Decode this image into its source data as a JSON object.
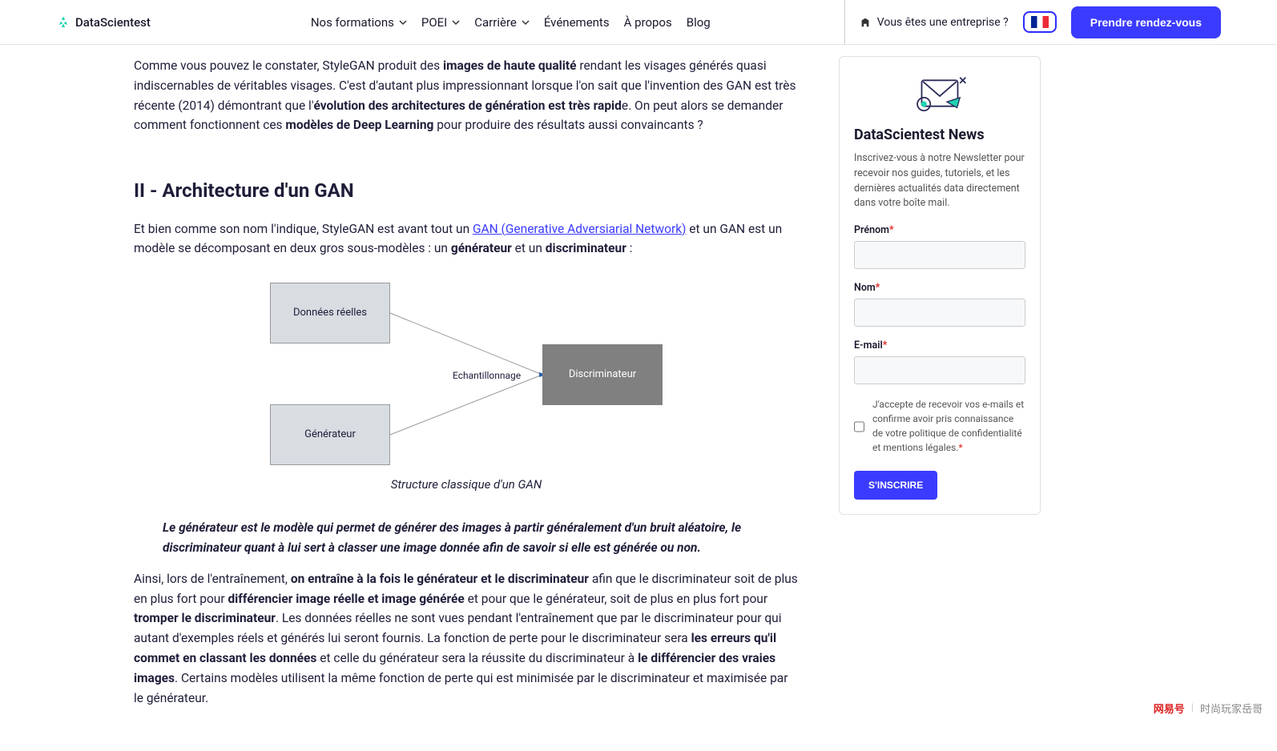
{
  "header": {
    "logo_text": "DataScientest",
    "nav": {
      "formations": "Nos formations",
      "poei": "POEI",
      "carriere": "Carrière",
      "evenements": "Événements",
      "apropos": "À propos",
      "blog": "Blog"
    },
    "enterprise_text": "Vous êtes une entreprise ?",
    "cta": "Prendre rendez-vous"
  },
  "article": {
    "p1_a": "Comme vous pouvez le constater, StyleGAN produit des ",
    "p1_b1": "images de haute qualité",
    "p1_c": " rendant les visages générés quasi indiscernables de véritables visages. C'est d'autant plus impressionnant lorsque l'on sait que l'invention des GAN est très récente (2014) démontrant que l'",
    "p1_b2": "évolution des architectures de génération est très rapid",
    "p1_d": "e. On peut alors se demander comment fonctionnent ces ",
    "p1_b3": "modèles de Deep Learning",
    "p1_e": " pour produire des résultats aussi convaincants ?",
    "h2": "II - Architecture d'un GAN",
    "p2_a": "Et bien comme son nom l'indique, StyleGAN est avant tout un ",
    "p2_link": "GAN (Generative Adversiarial Network)",
    "p2_b": " et un GAN est un modèle se décomposant en deux gros sous-modèles : un ",
    "p2_b1": "générateur",
    "p2_c": " et un ",
    "p2_b2": "discriminateur",
    "p2_d": " :",
    "diagram": {
      "donnees": "Données réelles",
      "generateur": "Générateur",
      "echant": "Echantillonnage",
      "discrim": "Discriminateur"
    },
    "caption": "Structure classique d'un GAN",
    "quote": "Le générateur est le modèle qui permet de générer des images à partir généralement d'un bruit aléatoire, le discriminateur quant à lui sert à classer une image donnée afin de savoir si elle est générée ou non.",
    "p3_a": "Ainsi, lors de l'entraînement, ",
    "p3_b1": "on entraîne à la fois le générateur et le discriminateur",
    "p3_b": " afin que le discriminateur soit de plus en plus fort pour ",
    "p3_b2": "différencier image réelle et image générée",
    "p3_c": " et pour que le générateur, soit de plus en plus fort pour ",
    "p3_b3": "tromper le discriminateur",
    "p3_d": ". Les données réelles ne sont vues pendant l'entraînement que par le discriminateur pour qui autant d'exemples réels et générés lui seront fournis. La fonction de perte pour le discriminateur sera ",
    "p3_b4": "les erreurs qu'il commet en classant les données",
    "p3_e": " et celle du générateur sera la réussite du discriminateur à ",
    "p3_b5": "le différencier des vraies images",
    "p3_f": ". Certains modèles utilisent la même fonction de perte qui est minimisée par le discriminateur et maximisée par le générateur."
  },
  "sidebar": {
    "title": "DataScientest News",
    "desc": "Inscrivez-vous à notre Newsletter pour recevoir nos guides, tutoriels, et les dernières actualités data directement dans votre boîte mail.",
    "prenom": "Prénom",
    "nom": "Nom",
    "email": "E-mail",
    "consent": "J'accepte de recevoir vos e-mails et confirme avoir pris connaissance de votre politique de confidentialité et mentions légales.",
    "submit": "S'INSCRIRE"
  },
  "watermark": {
    "brand": "网易号",
    "author": "时尚玩家岳哥"
  }
}
